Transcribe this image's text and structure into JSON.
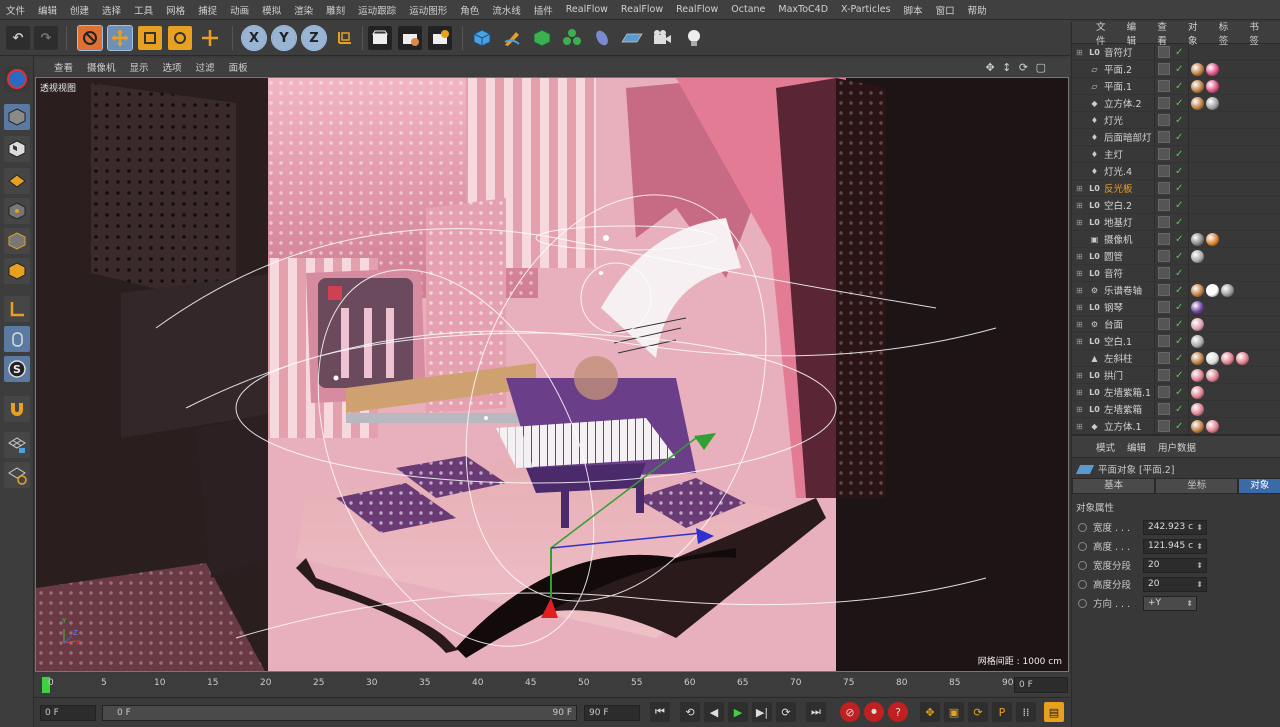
{
  "menubar": [
    "文件",
    "编辑",
    "创建",
    "选择",
    "工具",
    "网格",
    "捕捉",
    "动画",
    "模拟",
    "渲染",
    "雕刻",
    "运动跟踪",
    "运动图形",
    "角色",
    "流水线",
    "插件",
    "RealFlow",
    "RealFlow",
    "RealFlow",
    "Octane",
    "MaxToC4D",
    "X-Particles",
    "脚本",
    "窗口",
    "帮助"
  ],
  "toolbar": {
    "x": "X",
    "y": "Y",
    "z": "Z"
  },
  "viewport": {
    "menu": [
      "查看",
      "摄像机",
      "显示",
      "选项",
      "过滤",
      "面板"
    ],
    "label": "透视视图",
    "grid_distance": "网格间距 : 1000 cm",
    "axis_y": "Y",
    "axis_z": "Z",
    "axis_x": "X"
  },
  "timeline": {
    "ticks": [
      "0",
      "5",
      "10",
      "15",
      "20",
      "25",
      "30",
      "35",
      "40",
      "45",
      "50",
      "55",
      "60",
      "65",
      "70",
      "75",
      "80",
      "85",
      "90"
    ],
    "frame_field": "0 F"
  },
  "transport": {
    "start_field": "0 F",
    "range_start": "0 F",
    "range_end": "90 F",
    "end_field": "90 F"
  },
  "object_manager": {
    "menu": [
      "文件",
      "编辑",
      "查看",
      "对象",
      "标签",
      "书签"
    ],
    "objects": [
      {
        "name": "音符灯",
        "icon": "L0",
        "expand": "⊞"
      },
      {
        "name": "平面.2",
        "icon": "▱",
        "expand": "",
        "tags": [
          "#c08040",
          "#e0508a"
        ]
      },
      {
        "name": "平面.1",
        "icon": "▱",
        "expand": "",
        "tags": [
          "#c08040",
          "#e0508a"
        ]
      },
      {
        "name": "立方体.2",
        "icon": "◆",
        "expand": "",
        "tags": [
          "#c08040",
          "#a0a0a0"
        ]
      },
      {
        "name": "灯光",
        "icon": "♦",
        "expand": ""
      },
      {
        "name": "后面暗部灯",
        "icon": "♦",
        "expand": ""
      },
      {
        "name": "主灯",
        "icon": "♦",
        "expand": ""
      },
      {
        "name": "灯光.4",
        "icon": "♦",
        "expand": ""
      },
      {
        "name": "反光板",
        "icon": "L0",
        "expand": "⊞",
        "highlight": true
      },
      {
        "name": "空白.2",
        "icon": "L0",
        "expand": "⊞"
      },
      {
        "name": "地基灯",
        "icon": "L0",
        "expand": "⊞"
      },
      {
        "name": "摄像机",
        "icon": "▣",
        "expand": "",
        "tags": [
          "#888888",
          "#e08030"
        ]
      },
      {
        "name": "圆管",
        "icon": "L0",
        "expand": "⊞",
        "tags": [
          "#aaaaaa"
        ]
      },
      {
        "name": "音符",
        "icon": "L0",
        "expand": "⊞"
      },
      {
        "name": "乐谱卷轴",
        "icon": "⚙",
        "expand": "⊞",
        "tags": [
          "#c08040",
          "#ffffff",
          "#999999"
        ]
      },
      {
        "name": "钢琴",
        "icon": "L0",
        "expand": "⊞",
        "tags": [
          "#7040a0"
        ]
      },
      {
        "name": "台面",
        "icon": "⚙",
        "expand": "⊞",
        "tags": [
          "#e0a0b0"
        ]
      },
      {
        "name": "空白.1",
        "icon": "L0",
        "expand": "⊞",
        "tags": [
          "#aaaaaa"
        ]
      },
      {
        "name": "左斜柱",
        "icon": "▲",
        "expand": "",
        "tags": [
          "#c08040",
          "#dddddd",
          "#e08090",
          "#e08090"
        ]
      },
      {
        "name": "拱门",
        "icon": "L0",
        "expand": "⊞",
        "tags": [
          "#e08090",
          "#e08090"
        ]
      },
      {
        "name": "左墙紫箱.1",
        "icon": "L0",
        "expand": "⊞",
        "tags": [
          "#e08090"
        ]
      },
      {
        "name": "左墙紫箱",
        "icon": "L0",
        "expand": "⊞",
        "tags": [
          "#e08090"
        ]
      },
      {
        "name": "立方体.1",
        "icon": "◆",
        "expand": "⊞",
        "tags": [
          "#c08040",
          "#e08090"
        ]
      }
    ]
  },
  "attributes": {
    "menu": [
      "模式",
      "编辑",
      "用户数据"
    ],
    "title": "平面对象 [平面.2]",
    "tabs": [
      "基本",
      "坐标",
      "对象"
    ],
    "section": "对象属性",
    "fields": [
      {
        "label": "宽度 . . .",
        "value": "242.923 c"
      },
      {
        "label": "高度 . . .",
        "value": "121.945 c"
      },
      {
        "label": "宽度分段",
        "value": "20"
      },
      {
        "label": "高度分段",
        "value": "20"
      },
      {
        "label": "方向 . . .",
        "value": "+Y"
      }
    ]
  }
}
